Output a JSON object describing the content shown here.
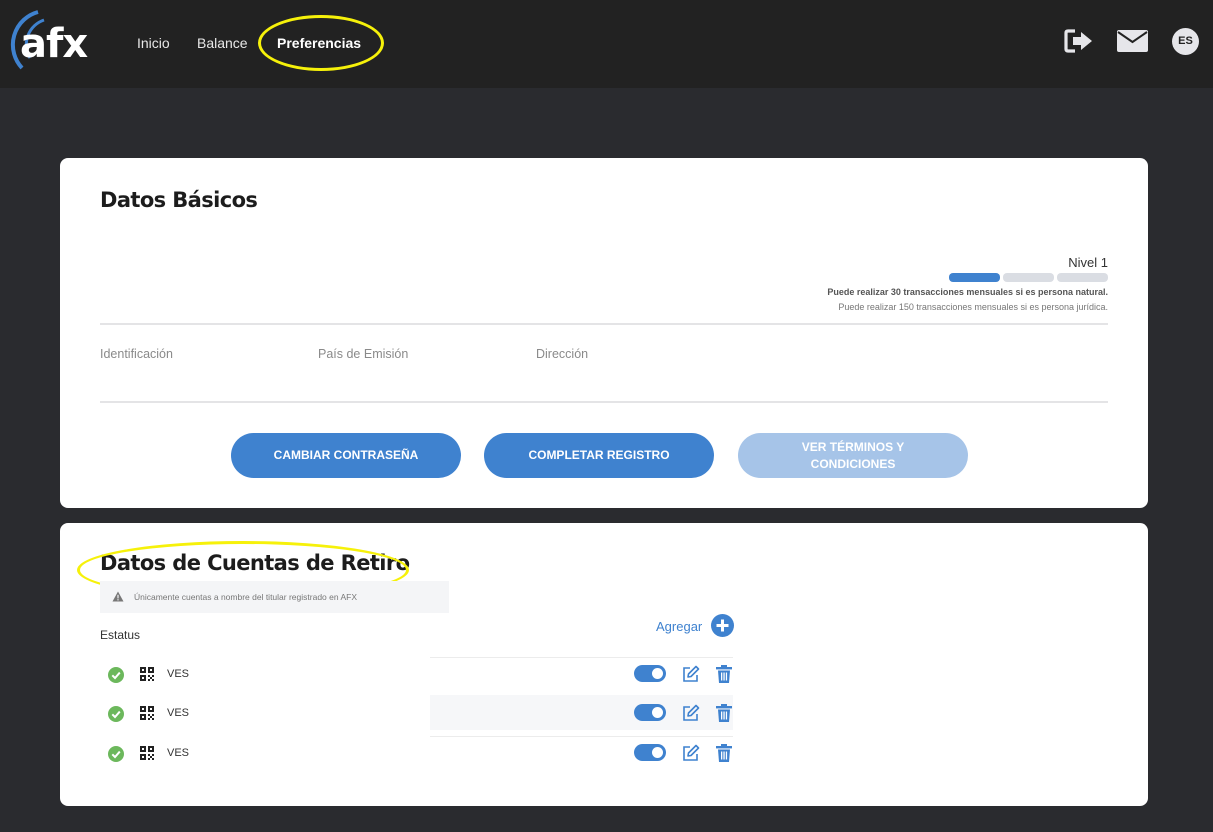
{
  "header": {
    "logo_text": "afx",
    "nav": [
      {
        "label": "Inicio"
      },
      {
        "label": "Balance"
      },
      {
        "label": "Preferencias",
        "active": true
      }
    ],
    "icons": [
      "logout-icon",
      "envelope-icon"
    ],
    "language": "ES"
  },
  "basic_data": {
    "title": "Datos Básicos",
    "level": {
      "label": "Nivel 1",
      "progress": 1,
      "total": 3,
      "note_natural": "Puede realizar 30 transacciones mensuales si es persona natural.",
      "note_juridica": "Puede realizar 150 transacciones mensuales si es persona jurídica."
    },
    "fields": [
      {
        "label": "Identificación"
      },
      {
        "label": "País de Emisión"
      },
      {
        "label": "Dirección"
      }
    ],
    "buttons": {
      "change_password": "CAMBIAR CONTRASEÑA",
      "complete_registration": "COMPLETAR REGISTRO",
      "terms": "VER TÉRMINOS Y CONDICIONES"
    }
  },
  "withdrawal_accounts": {
    "title": "Datos de Cuentas de Retiro",
    "notice": "Únicamente cuentas a nombre del titular registrado en AFX",
    "status_label": "Estatus",
    "add_label": "Agregar",
    "rows": [
      {
        "currency": "VES",
        "enabled": true
      },
      {
        "currency": "VES",
        "enabled": true
      },
      {
        "currency": "VES",
        "enabled": true
      }
    ]
  },
  "colors": {
    "accent": "#3f82cf",
    "accent_disabled": "#a6c4e8",
    "success": "#6cb85c",
    "highlight": "#f6f10a",
    "topbar": "#222222",
    "background": "#2a2b2f"
  }
}
